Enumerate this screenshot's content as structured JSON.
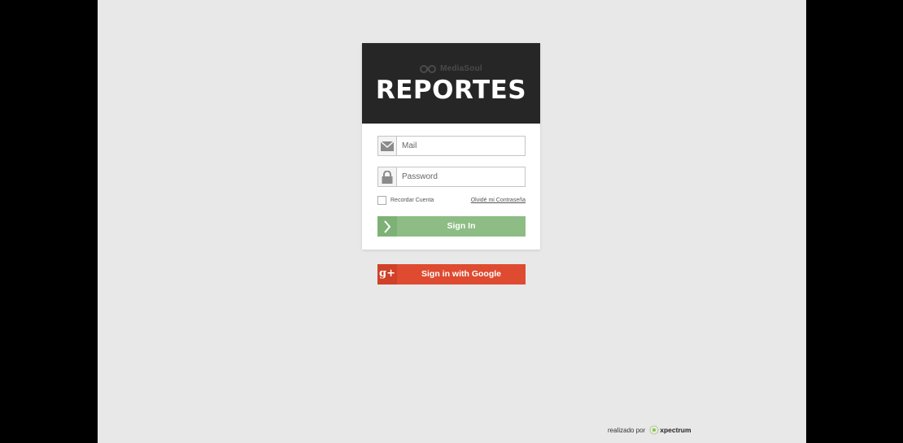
{
  "header": {
    "brand": "MediaSoul",
    "title": "REPORTES"
  },
  "login": {
    "mail_placeholder": "Mail",
    "password_placeholder": "Password",
    "remember_label": "Recordar Cuenta",
    "forgot_label": "Olvidé mi Contraseña",
    "signin_label": "Sign In",
    "google_label": "Sign in with Google",
    "google_icon_text": "g+"
  },
  "footer": {
    "credit_prefix": "realizado por",
    "credit_brand": "xpectrum"
  },
  "icons": {
    "mail": "envelope-icon",
    "password": "lock-icon",
    "signin": "chevron-right-icon",
    "google": "google-plus-icon"
  },
  "colors": {
    "background": "#e8e8e8",
    "header": "#262626",
    "signin": "#8dbd84",
    "google": "#de4b30"
  }
}
